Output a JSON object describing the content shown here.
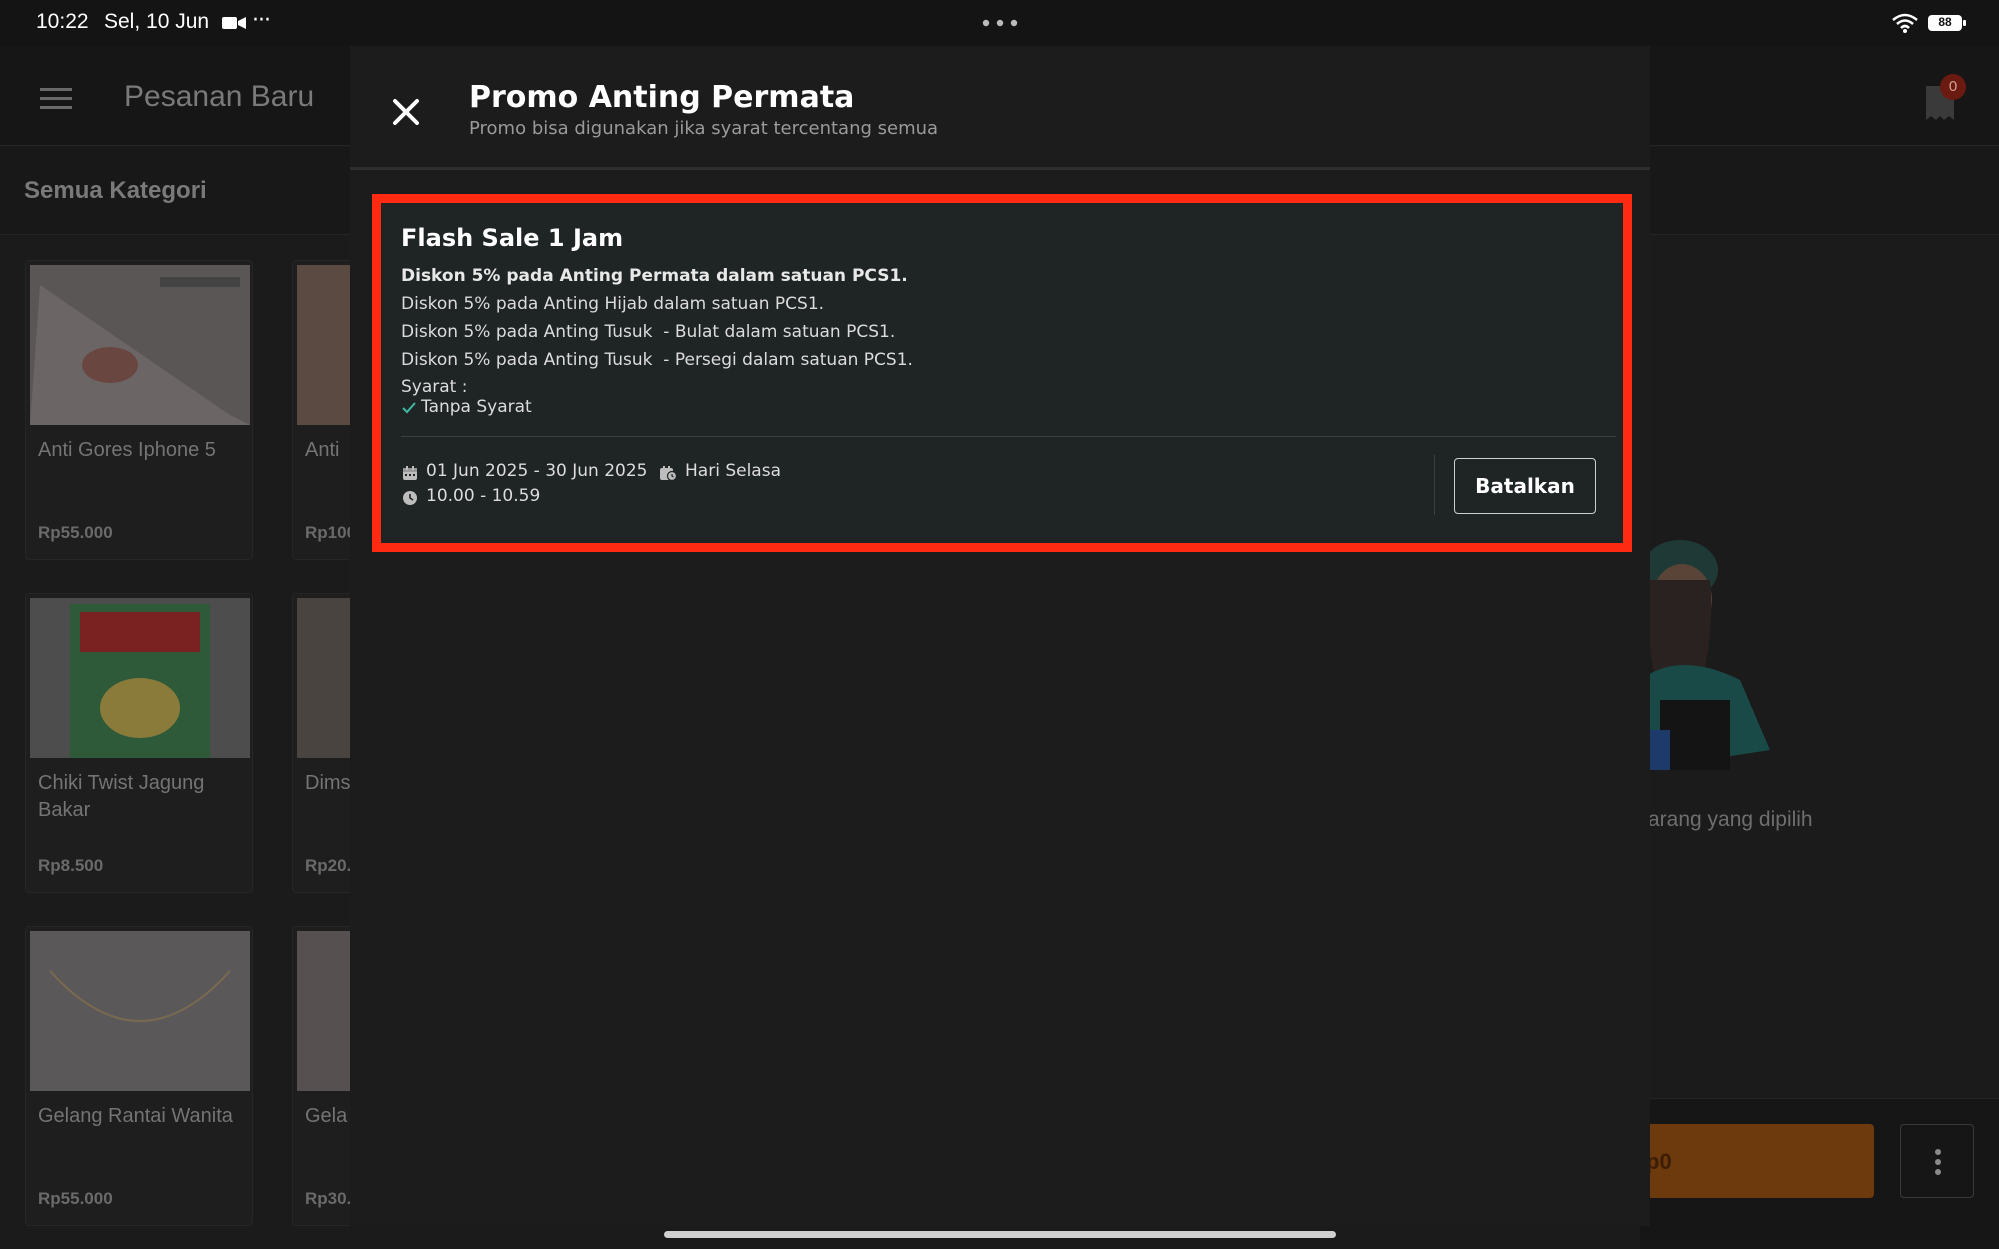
{
  "status_bar": {
    "time": "10:22",
    "date": "Sel, 10 Jun",
    "extra": "···",
    "battery": "88"
  },
  "app": {
    "title": "Pesanan Baru",
    "cart_count": "0",
    "category": "Semua Kategori",
    "products": [
      {
        "name": "Anti Gores Iphone 5",
        "price": "Rp55.000"
      },
      {
        "name": "Anti",
        "price": "Rp100"
      },
      {
        "name": "Chiki Twist Jagung Bakar",
        "price": "Rp8.500"
      },
      {
        "name": "Dims",
        "price": "Rp20."
      },
      {
        "name": "Gelang Rantai Wanita",
        "price": "Rp55.000"
      },
      {
        "name": "Gela wani",
        "price": "Rp30."
      }
    ],
    "empty_text": "arang yang dipilih",
    "pay_label": "p0"
  },
  "modal": {
    "title": "Promo Anting Permata",
    "subtitle": "Promo bisa digunakan jika syarat tercentang semua",
    "promo": {
      "name": "Flash Sale 1 Jam",
      "lines": [
        "Diskon 5% pada Anting Permata dalam satuan PCS1.",
        "Diskon 5% pada Anting Hijab dalam satuan PCS1.",
        "Diskon 5% pada Anting Tusuk  - Bulat dalam satuan PCS1.",
        "Diskon 5% pada Anting Tusuk  - Persegi dalam satuan PCS1."
      ],
      "requirements_label": "Syarat :",
      "requirement": "Tanpa Syarat",
      "date_range": "01 Jun 2025 - 30 Jun 2025",
      "day": "Hari Selasa",
      "time_range": "10.00 - 10.59",
      "cancel_label": "Batalkan"
    }
  },
  "colors": {
    "highlight": "#ff2a12",
    "check": "#3fb8a8"
  }
}
